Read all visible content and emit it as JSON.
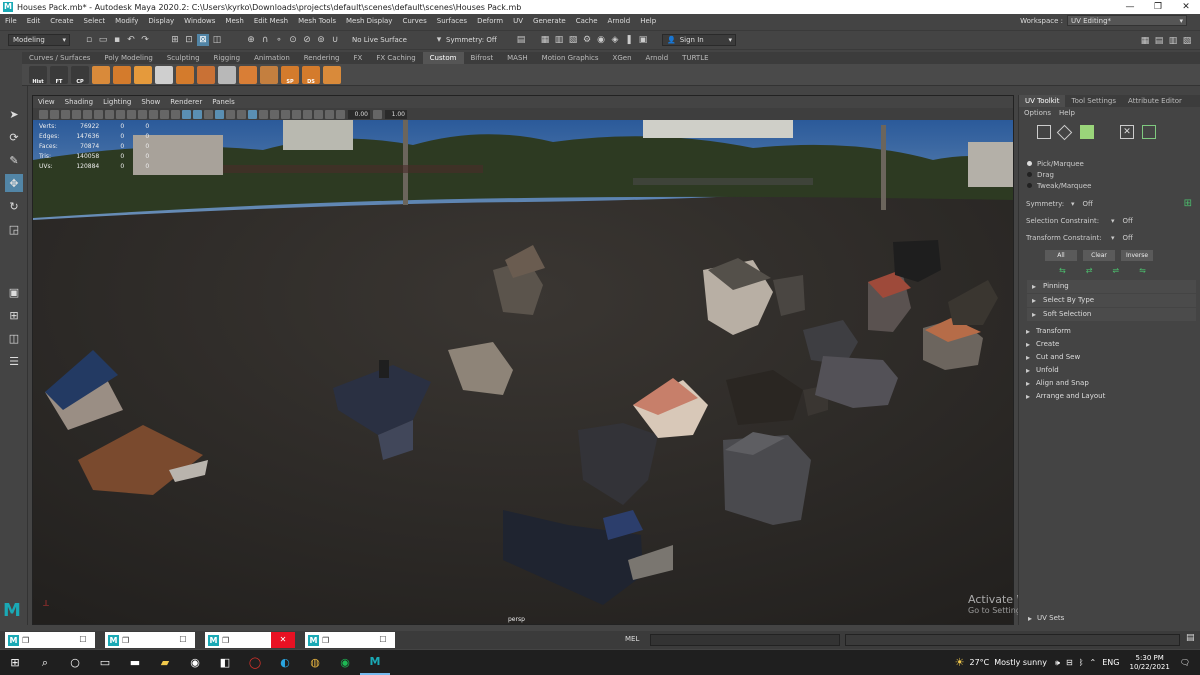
{
  "titlebar": {
    "logo": "M",
    "title": "Houses Pack.mb* - Autodesk Maya 2020.2: C:\\Users\\kyrko\\Downloads\\projects\\default\\scenes\\default\\scenes\\Houses Pack.mb",
    "minimize": "—",
    "maximize": "❐",
    "close": "✕"
  },
  "menubar": {
    "items": [
      "File",
      "Edit",
      "Create",
      "Select",
      "Modify",
      "Display",
      "Windows",
      "Mesh",
      "Edit Mesh",
      "Mesh Tools",
      "Mesh Display",
      "Curves",
      "Surfaces",
      "Deform",
      "UV",
      "Generate",
      "Cache",
      "Arnold",
      "Help"
    ],
    "workspace_label": "Workspace :",
    "workspace_value": "UV Editing*"
  },
  "statusline": {
    "mode": "Modeling",
    "live_surface": "No Live Surface",
    "symmetry": "Symmetry: Off",
    "sign_in": "Sign In"
  },
  "shelf": {
    "tabs": [
      "Curves / Surfaces",
      "Poly Modeling",
      "Sculpting",
      "Rigging",
      "Animation",
      "Rendering",
      "FX",
      "FX Caching",
      "Custom",
      "Bifrost",
      "MASH",
      "Motion Graphics",
      "XGen",
      "Arnold",
      "TURTLE"
    ],
    "active_tab": "Custom",
    "buttons": [
      {
        "label": "Hist",
        "color": "#3a3a3a"
      },
      {
        "label": "FT",
        "color": "#3a3a3a"
      },
      {
        "label": "CP",
        "color": "#3a3a3a"
      },
      {
        "label": "",
        "color": "#d98a3a"
      },
      {
        "label": "",
        "color": "#d47b2c"
      },
      {
        "label": "",
        "color": "#e59a3c"
      },
      {
        "label": "",
        "color": "#cfcfcf"
      },
      {
        "label": "",
        "color": "#d47b2c"
      },
      {
        "label": "",
        "color": "#c97135"
      },
      {
        "label": "",
        "color": "#b8b8b8"
      },
      {
        "label": "",
        "color": "#d97e36"
      },
      {
        "label": "",
        "color": "#c47f3f"
      },
      {
        "label": "SP",
        "color": "#d47b2c"
      },
      {
        "label": "DS",
        "color": "#d47b2c"
      },
      {
        "label": "",
        "color": "#d98a3a"
      }
    ]
  },
  "viewport": {
    "menu": [
      "View",
      "Shading",
      "Lighting",
      "Show",
      "Renderer",
      "Panels"
    ],
    "near_value": "0.00",
    "far_value": "1.00",
    "camera_label": "persp",
    "hud": [
      {
        "label": "Verts:",
        "value": "76922",
        "sel": "0",
        "comp": "0"
      },
      {
        "label": "Edges:",
        "value": "147636",
        "sel": "0",
        "comp": "0"
      },
      {
        "label": "Faces:",
        "value": "70874",
        "sel": "0",
        "comp": "0"
      },
      {
        "label": "Tris:",
        "value": "140058",
        "sel": "0",
        "comp": "0"
      },
      {
        "label": "UVs:",
        "value": "120884",
        "sel": "0",
        "comp": "0"
      }
    ]
  },
  "activate_windows": {
    "title": "Activate Windows",
    "subtitle": "Go to Settings to activate Windows."
  },
  "right_panel": {
    "tabs": [
      "UV Toolkit",
      "Tool Settings",
      "Attribute Editor"
    ],
    "submenu": [
      "Options",
      "Help"
    ],
    "pick_modes": [
      {
        "label": "Pick/Marquee",
        "on": true
      },
      {
        "label": "Drag",
        "on": false
      },
      {
        "label": "Tweak/Marquee",
        "on": false
      }
    ],
    "symmetry_label": "Symmetry:",
    "symmetry_value": "Off",
    "selection_constraint_label": "Selection Constraint:",
    "selection_constraint_value": "Off",
    "transform_constraint_label": "Transform Constraint:",
    "transform_constraint_value": "Off",
    "buttons": [
      "All",
      "Clear",
      "Inverse"
    ],
    "subsections": [
      "Pinning",
      "Select By Type",
      "Soft Selection"
    ],
    "sections": [
      "Transform",
      "Create",
      "Cut and Sew",
      "Unfold",
      "Align and Snap",
      "Arrange and Layout"
    ],
    "uv_sets": "UV Sets"
  },
  "bottom": {
    "mel_label": "MEL",
    "maya_tasks": [
      {
        "close_red": false
      },
      {
        "close_red": false
      },
      {
        "close_red": true
      },
      {
        "close_red": false
      }
    ]
  },
  "taskbar": {
    "weather_temp": "27°C",
    "weather_text": "Mostly sunny",
    "lang": "ENG",
    "time": "5:30 PM",
    "date": "10/22/2021"
  },
  "colors": {
    "accent": "#5285a6",
    "maya_teal": "#1aa9b5"
  }
}
